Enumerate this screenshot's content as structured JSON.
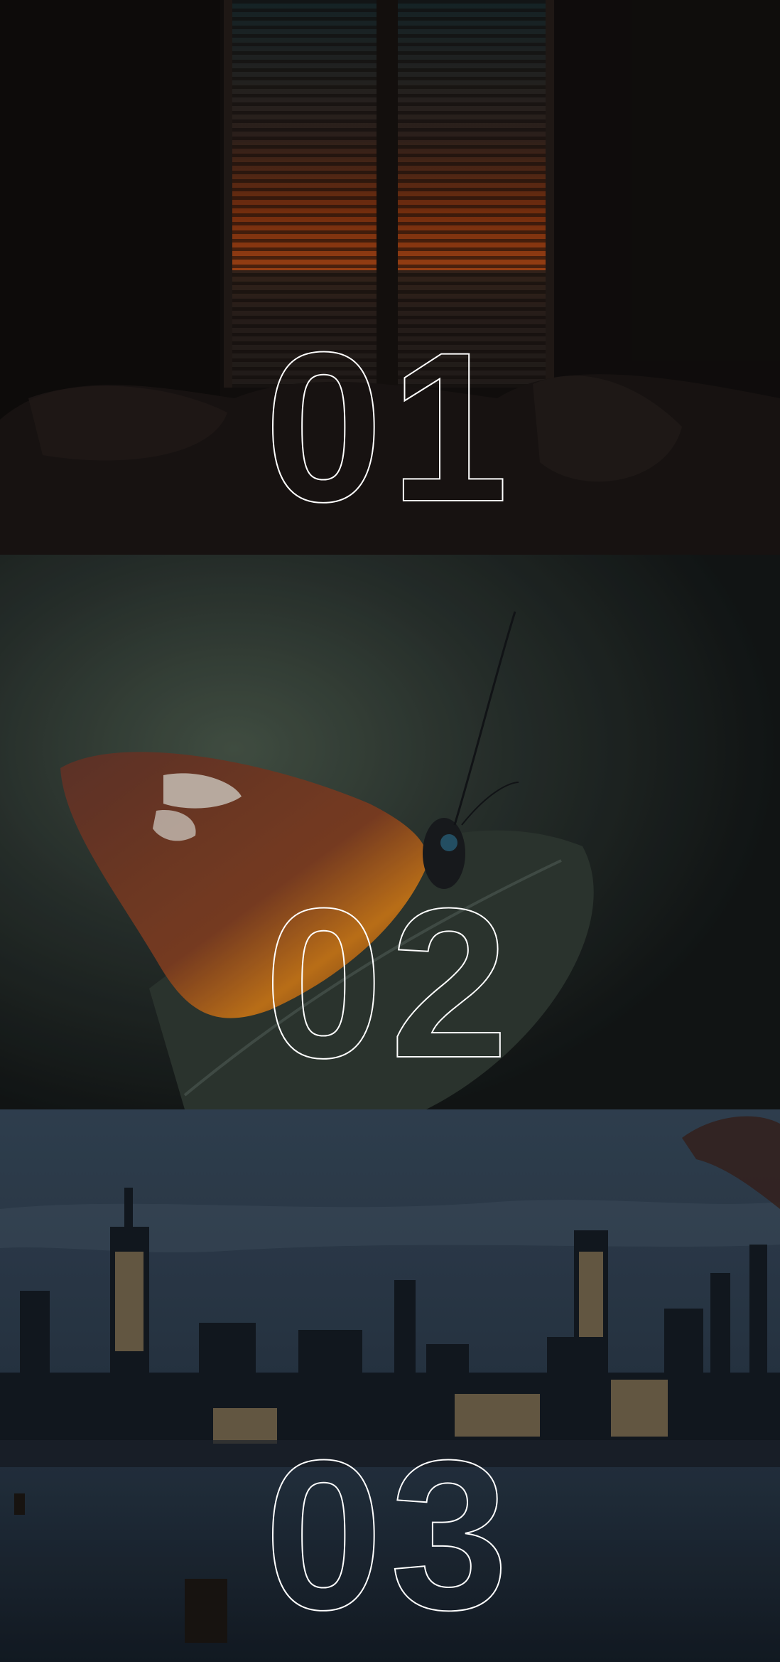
{
  "panels": [
    {
      "number": "01",
      "subject": "window-blinds-sunset"
    },
    {
      "number": "02",
      "subject": "butterfly-on-leaf"
    },
    {
      "number": "03",
      "subject": "city-skyline-night"
    }
  ],
  "colors": {
    "sunset": "#c9541a",
    "butterfly_orange": "#d9811c",
    "night_sky": "#344556",
    "outline": "#ffffff"
  }
}
